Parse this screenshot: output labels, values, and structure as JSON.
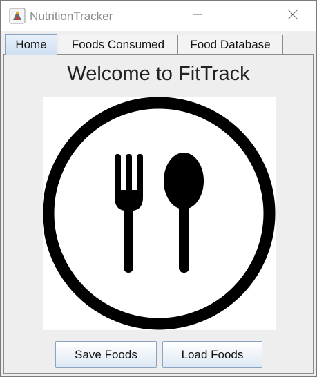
{
  "window": {
    "title": "NutritionTracker",
    "app_icon": "java-app-icon",
    "controls": [
      "minimize-icon",
      "maximize-icon",
      "close-icon"
    ]
  },
  "tabs": [
    {
      "label": "Home",
      "active": true
    },
    {
      "label": "Foods Consumed",
      "active": false
    },
    {
      "label": "Food Database",
      "active": false
    }
  ],
  "home": {
    "heading": "Welcome to FitTrack",
    "logo": "fork-spoon-plate-icon",
    "buttons": {
      "save_label": "Save Foods",
      "load_label": "Load Foods"
    }
  },
  "colors": {
    "panel_background": "#eeeeee",
    "active_tab": "#cfe0f2",
    "button_border": "#8aa3c2"
  }
}
